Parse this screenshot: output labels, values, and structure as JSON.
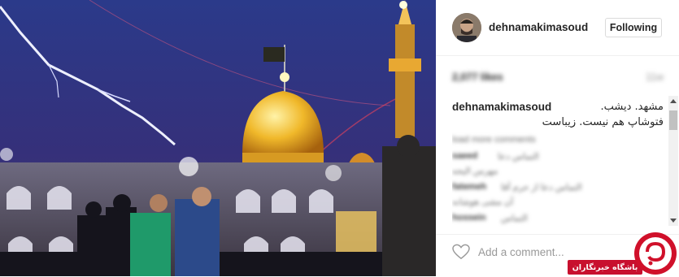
{
  "post": {
    "username": "dehnamakimasoud",
    "follow_label": "Following",
    "likes_text": "2,077 likes",
    "time_text": "11w",
    "caption_username": "dehnamakimasoud",
    "caption_lines": [
      "مشهد. دیشب.",
      "فتوشاپ هم نیست. زیباست"
    ],
    "load_more_text": "load more comments",
    "comments": [
      {
        "user": "saeed",
        "text": "التماس دعا"
      },
      {
        "user": "",
        "text": "مهرس الیحه"
      },
      {
        "user": "fatemeh",
        "text": "التماس دعا از حرم آقا"
      },
      {
        "user": "",
        "text": "آن مشی هوشانه"
      },
      {
        "user": "hossein",
        "text": "التماس"
      }
    ],
    "comment_placeholder": "Add a comment..."
  },
  "photo": {
    "description_colors": {
      "sky": "#24307a",
      "dome": "#e0a825",
      "lightning": "#e8e8ff"
    }
  },
  "icons": {
    "like": "heart-icon",
    "avatar": "avatar",
    "watermark": "watermark-logo"
  },
  "watermark": {
    "text": "باشگاه خبرنگاران"
  }
}
